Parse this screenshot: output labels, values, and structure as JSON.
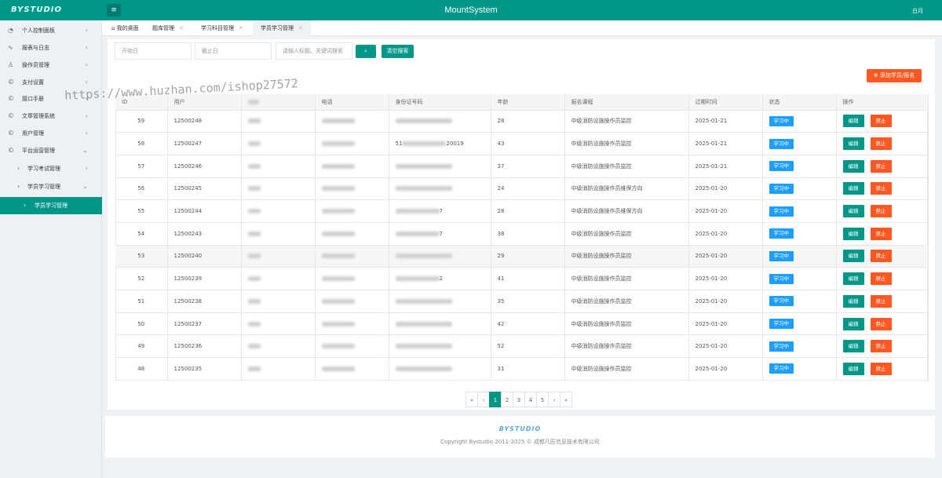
{
  "header": {
    "logo": "BYSTUDIO",
    "title": "MountSystem",
    "user": "白月"
  },
  "sidebar": {
    "items": [
      {
        "label": "个人控制面板",
        "icon": "dashboard-icon"
      },
      {
        "label": "报表与日志",
        "icon": "activity-icon"
      },
      {
        "label": "操作员管理",
        "icon": "user-icon"
      },
      {
        "label": "支付设置",
        "icon": "copyright-icon"
      },
      {
        "label": "接口手册",
        "icon": "copyright-icon"
      },
      {
        "label": "文章管理系统",
        "icon": "copyright-icon"
      },
      {
        "label": "用户管理",
        "icon": "copyright-icon"
      },
      {
        "label": "平台运营管理",
        "icon": "copyright-icon"
      }
    ],
    "sub_items": [
      {
        "label": "学习考试管理"
      },
      {
        "label": "学员学习管理"
      }
    ],
    "active_item": "学员学习管理"
  },
  "tabs": [
    {
      "label": "我的桌面"
    },
    {
      "label": "题库管理"
    },
    {
      "label": "学习科目管理"
    },
    {
      "label": "学员学习管理"
    }
  ],
  "filters": {
    "start_placeholder": "开始日",
    "end_placeholder": "截止日",
    "keyword_placeholder": "请输入标题、关键词搜索",
    "clear_label": "清空搜索",
    "add_label": "添加学员/报名"
  },
  "table": {
    "columns": [
      "ID",
      "用户",
      "",
      "电话",
      "身份证号码",
      "年龄",
      "报名课程",
      "过期时间",
      "状态",
      "操作"
    ],
    "rows": [
      {
        "id": "59",
        "user": "12500248",
        "age": "28",
        "course": "中级消防设施操作员监控",
        "expire": "2025-01-21",
        "status": "学习中"
      },
      {
        "id": "58",
        "user": "12500247",
        "id_frag": "51",
        "id_frag2": "20019",
        "age": "43",
        "course": "中级消防设施操作员监控",
        "expire": "2025-01-21",
        "status": "学习中"
      },
      {
        "id": "57",
        "user": "12500246",
        "age": "37",
        "course": "中级消防设施操作员监控",
        "expire": "2025-01-21",
        "status": "学习中"
      },
      {
        "id": "56",
        "user": "12500245",
        "age": "24",
        "course": "中级消防设施操作员维保方向",
        "expire": "2025-01-20",
        "status": "学习中"
      },
      {
        "id": "55",
        "user": "12500244",
        "id_frag2": "7",
        "age": "28",
        "course": "中级消防设施操作员维保方向",
        "expire": "2025-01-20",
        "status": "学习中"
      },
      {
        "id": "54",
        "user": "12500243",
        "id_frag2": "7",
        "age": "38",
        "course": "中级消防设施操作员监控",
        "expire": "2025-01-20",
        "status": "学习中"
      },
      {
        "id": "53",
        "user": "12500240",
        "age": "29",
        "course": "中级消防设施操作员监控",
        "expire": "2025-01-20",
        "status": "学习中"
      },
      {
        "id": "52",
        "user": "12500239",
        "id_frag2": "2",
        "age": "41",
        "course": "中级消防设施操作员监控",
        "expire": "2025-01-20",
        "status": "学习中"
      },
      {
        "id": "51",
        "user": "12500238",
        "age": "35",
        "course": "中级消防设施操作员监控",
        "expire": "2025-01-20",
        "status": "学习中"
      },
      {
        "id": "50",
        "user": "12500237",
        "age": "42",
        "course": "中级消防设施操作员监控",
        "expire": "2025-01-20",
        "status": "学习中"
      },
      {
        "id": "49",
        "user": "12500236",
        "age": "52",
        "course": "中级消防设施操作员监控",
        "expire": "2025-01-20",
        "status": "学习中"
      },
      {
        "id": "48",
        "user": "12500235",
        "age": "31",
        "course": "中级消防设施操作员监控",
        "expire": "2025-01-20",
        "status": "学习中"
      }
    ],
    "edit_label": "编辑",
    "ban_label": "禁止"
  },
  "pagination": {
    "first": "«",
    "prev": "‹",
    "pages": [
      "1",
      "2",
      "3",
      "4",
      "5"
    ],
    "current": "1",
    "next": "›",
    "last": "»"
  },
  "footer": {
    "logo": "BYSTUDIO",
    "copyright": "Copyright Bystudio 2011-2025 © 成都凡匠信息技术有限公司"
  },
  "watermark": "https://www.huzhan.com/ishop27572",
  "colors": {
    "primary": "#009688",
    "danger": "#ff5722",
    "info": "#1e9fff"
  }
}
